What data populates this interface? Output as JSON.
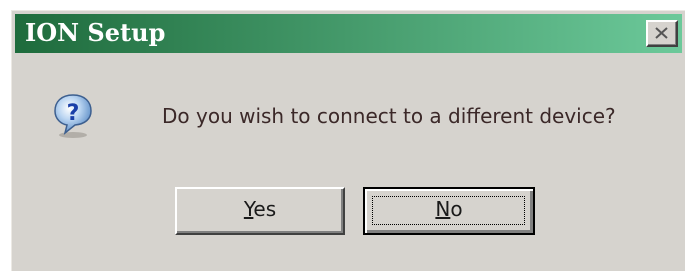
{
  "window": {
    "title": "ION Setup",
    "titlebar_gradient": [
      "#1e6b3c",
      "#6cc99a"
    ],
    "background": "#d6d3ce"
  },
  "dialog": {
    "icon": "question-icon",
    "message": "Do you wish to connect to a different device?",
    "buttons": {
      "yes": {
        "mnemonic": "Y",
        "rest": "es"
      },
      "no": {
        "mnemonic": "N",
        "rest": "o",
        "focused": true
      }
    }
  },
  "titlebar": {
    "close_icon": "close-icon"
  }
}
